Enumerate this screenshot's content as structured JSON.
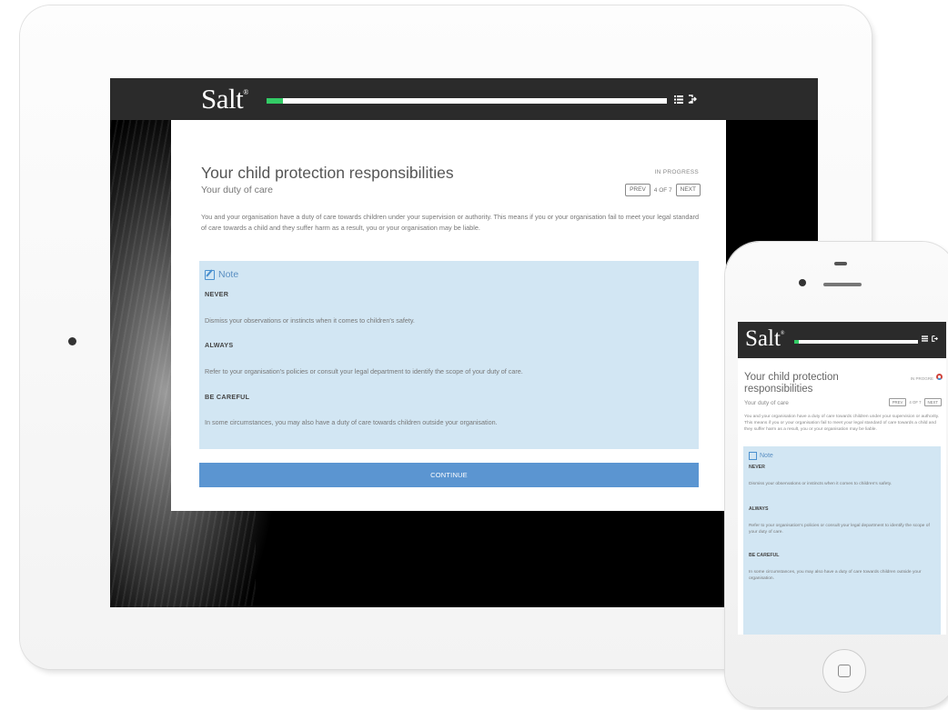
{
  "app": {
    "logo": "Salt",
    "logo_mark": "®",
    "progress_fraction": 0.04
  },
  "lesson": {
    "title": "Your child protection responsibilities",
    "subtitle": "Your duty of care",
    "status": "IN PROGRESS",
    "prev_label": "PREV",
    "page_count": "4 OF 7",
    "next_label": "NEXT",
    "intro": "You and your organisation have a duty of care towards children under your supervision or authority. This means if you or your organisation fail to meet your legal standard of care towards a child and they suffer harm as a result, you or your organisation may be liable."
  },
  "note": {
    "label": "Note",
    "sections": [
      {
        "heading": "NEVER",
        "text": "Dismiss your observations or instincts when it comes to children's safety."
      },
      {
        "heading": "ALWAYS",
        "text": "Refer to your organisation's policies or consult your legal department to identify the scope of your duty of care."
      },
      {
        "heading": "BE CAREFUL",
        "text": "In some circumstances, you may also have a duty of care towards children outside your organisation."
      }
    ]
  },
  "continue_label": "CONTINUE",
  "phone": {
    "logo": "Salt",
    "title": "Your child protection responsibilities",
    "subtitle": "Your duty of care",
    "status": "IN PROGRE",
    "prev_label": "PREV",
    "page_count": "4 OF 7",
    "next_label": "NEXT"
  },
  "colors": {
    "header_bg": "#2b2b2b",
    "progress": "#33cc66",
    "note_bg": "#d2e6f3",
    "accent": "#5b95d1"
  },
  "icons": [
    "menu-icon",
    "exit-icon",
    "note-edit-icon",
    "home-button-icon"
  ]
}
